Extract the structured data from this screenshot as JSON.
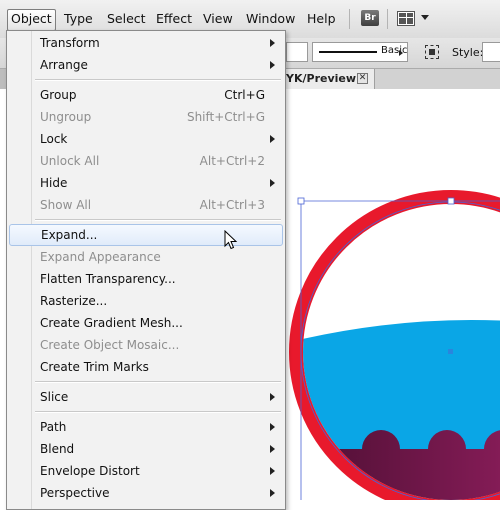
{
  "menubar": {
    "items": [
      "Object",
      "Type",
      "Select",
      "Effect",
      "View",
      "Window",
      "Help"
    ],
    "active_index": 0,
    "bridge_label": "Br",
    "icons": {
      "bridge": "bridge-icon",
      "workspace": "workspace-switcher-icon"
    }
  },
  "controlbar": {
    "stroke_profile_label": "Basic",
    "style_label": "Style:"
  },
  "document_tab": {
    "label": "YK/Preview)",
    "close_glyph": "✕"
  },
  "object_menu": {
    "items": [
      {
        "label": "Transform",
        "shortcut": "",
        "submenu": true,
        "disabled": false
      },
      {
        "label": "Arrange",
        "shortcut": "",
        "submenu": true,
        "disabled": false
      },
      {
        "separator": true
      },
      {
        "label": "Group",
        "shortcut": "Ctrl+G",
        "submenu": false,
        "disabled": false
      },
      {
        "label": "Ungroup",
        "shortcut": "Shift+Ctrl+G",
        "submenu": false,
        "disabled": true
      },
      {
        "label": "Lock",
        "shortcut": "",
        "submenu": true,
        "disabled": false
      },
      {
        "label": "Unlock All",
        "shortcut": "Alt+Ctrl+2",
        "submenu": false,
        "disabled": true
      },
      {
        "label": "Hide",
        "shortcut": "",
        "submenu": true,
        "disabled": false
      },
      {
        "label": "Show All",
        "shortcut": "Alt+Ctrl+3",
        "submenu": false,
        "disabled": true
      },
      {
        "separator": true
      },
      {
        "label": "Expand...",
        "shortcut": "",
        "submenu": false,
        "disabled": false,
        "highlighted": true
      },
      {
        "label": "Expand Appearance",
        "shortcut": "",
        "submenu": false,
        "disabled": true
      },
      {
        "label": "Flatten Transparency...",
        "shortcut": "",
        "submenu": false,
        "disabled": false
      },
      {
        "label": "Rasterize...",
        "shortcut": "",
        "submenu": false,
        "disabled": false
      },
      {
        "label": "Create Gradient Mesh...",
        "shortcut": "",
        "submenu": false,
        "disabled": false
      },
      {
        "label": "Create Object Mosaic...",
        "shortcut": "",
        "submenu": false,
        "disabled": true
      },
      {
        "label": "Create Trim Marks",
        "shortcut": "",
        "submenu": false,
        "disabled": false
      },
      {
        "separator": true
      },
      {
        "label": "Slice",
        "shortcut": "",
        "submenu": true,
        "disabled": false
      },
      {
        "separator": true
      },
      {
        "label": "Path",
        "shortcut": "",
        "submenu": true,
        "disabled": false
      },
      {
        "label": "Blend",
        "shortcut": "",
        "submenu": true,
        "disabled": false
      },
      {
        "label": "Envelope Distort",
        "shortcut": "",
        "submenu": true,
        "disabled": false
      },
      {
        "label": "Perspective",
        "shortcut": "",
        "submenu": true,
        "disabled": false
      }
    ]
  },
  "colors": {
    "ring_red": "#e8192c",
    "water_blue": "#0aa6e6",
    "base_maroon": "#6a1545",
    "selection_blue": "#4a63d4",
    "menu_highlight_border": "#a9c4e8"
  }
}
